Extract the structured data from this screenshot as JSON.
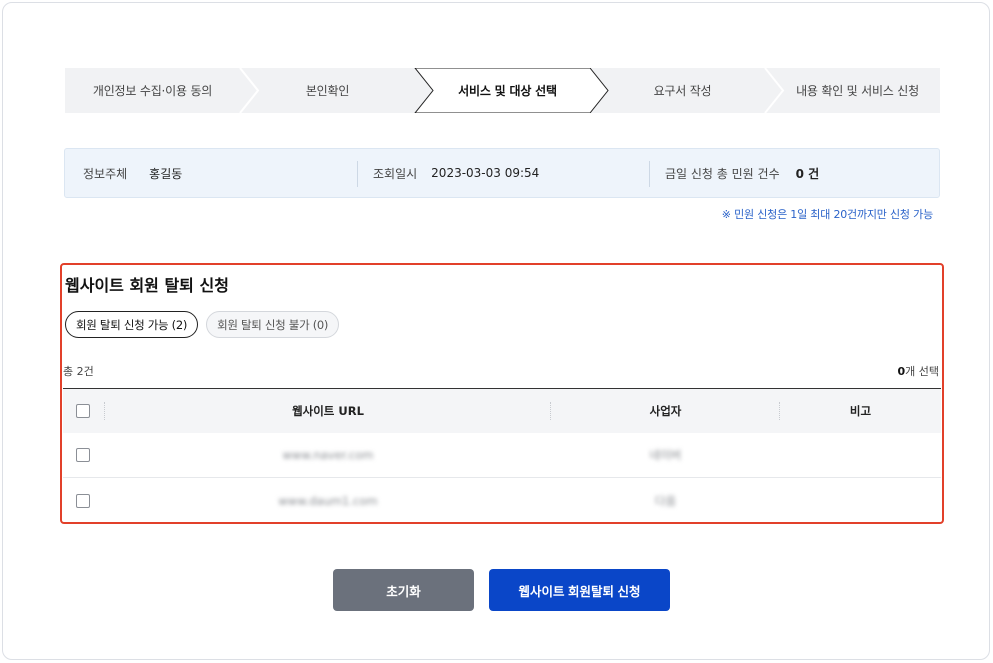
{
  "steps": [
    {
      "label": "개인정보 수집·이용 동의",
      "active": false
    },
    {
      "label": "본인확인",
      "active": false
    },
    {
      "label": "서비스 및 대상 선택",
      "active": true
    },
    {
      "label": "요구서 작성",
      "active": false
    },
    {
      "label": "내용 확인 및 서비스 신청",
      "active": false
    }
  ],
  "info": {
    "subject_label": "정보주체",
    "subject_value": "홍길동",
    "query_label": "조회일시",
    "query_value": "2023-03-03 09:54",
    "count_label": "금일 신청 총 민원 건수",
    "count_value": "0 건"
  },
  "notice": "※ 민원 신청은 1일 최대 20건까지만 신청 가능",
  "section": {
    "title": "웹사이트 회원 탈퇴 신청",
    "chip_available": "회원 탈퇴 신청 가능 (2)",
    "chip_unavailable": "회원 탈퇴 신청 불가 (0)",
    "total": "총 2건",
    "selected_count": "0",
    "selected_suffix": "개 선택"
  },
  "table": {
    "headers": {
      "url": "웹사이트 URL",
      "company": "사업자",
      "note": "비고"
    },
    "rows": [
      {
        "url": "www.naver.com",
        "company": "네이버",
        "note": "",
        "checked": false
      },
      {
        "url": "www.daum1.com",
        "company": "다음",
        "note": "",
        "checked": false
      }
    ]
  },
  "buttons": {
    "reset": "초기화",
    "submit": "웹사이트 회원탈퇴 신청"
  },
  "colors": {
    "accent_blue": "#0a46c8",
    "highlight_red": "#e2402a",
    "reset_gray": "#6b717c"
  }
}
